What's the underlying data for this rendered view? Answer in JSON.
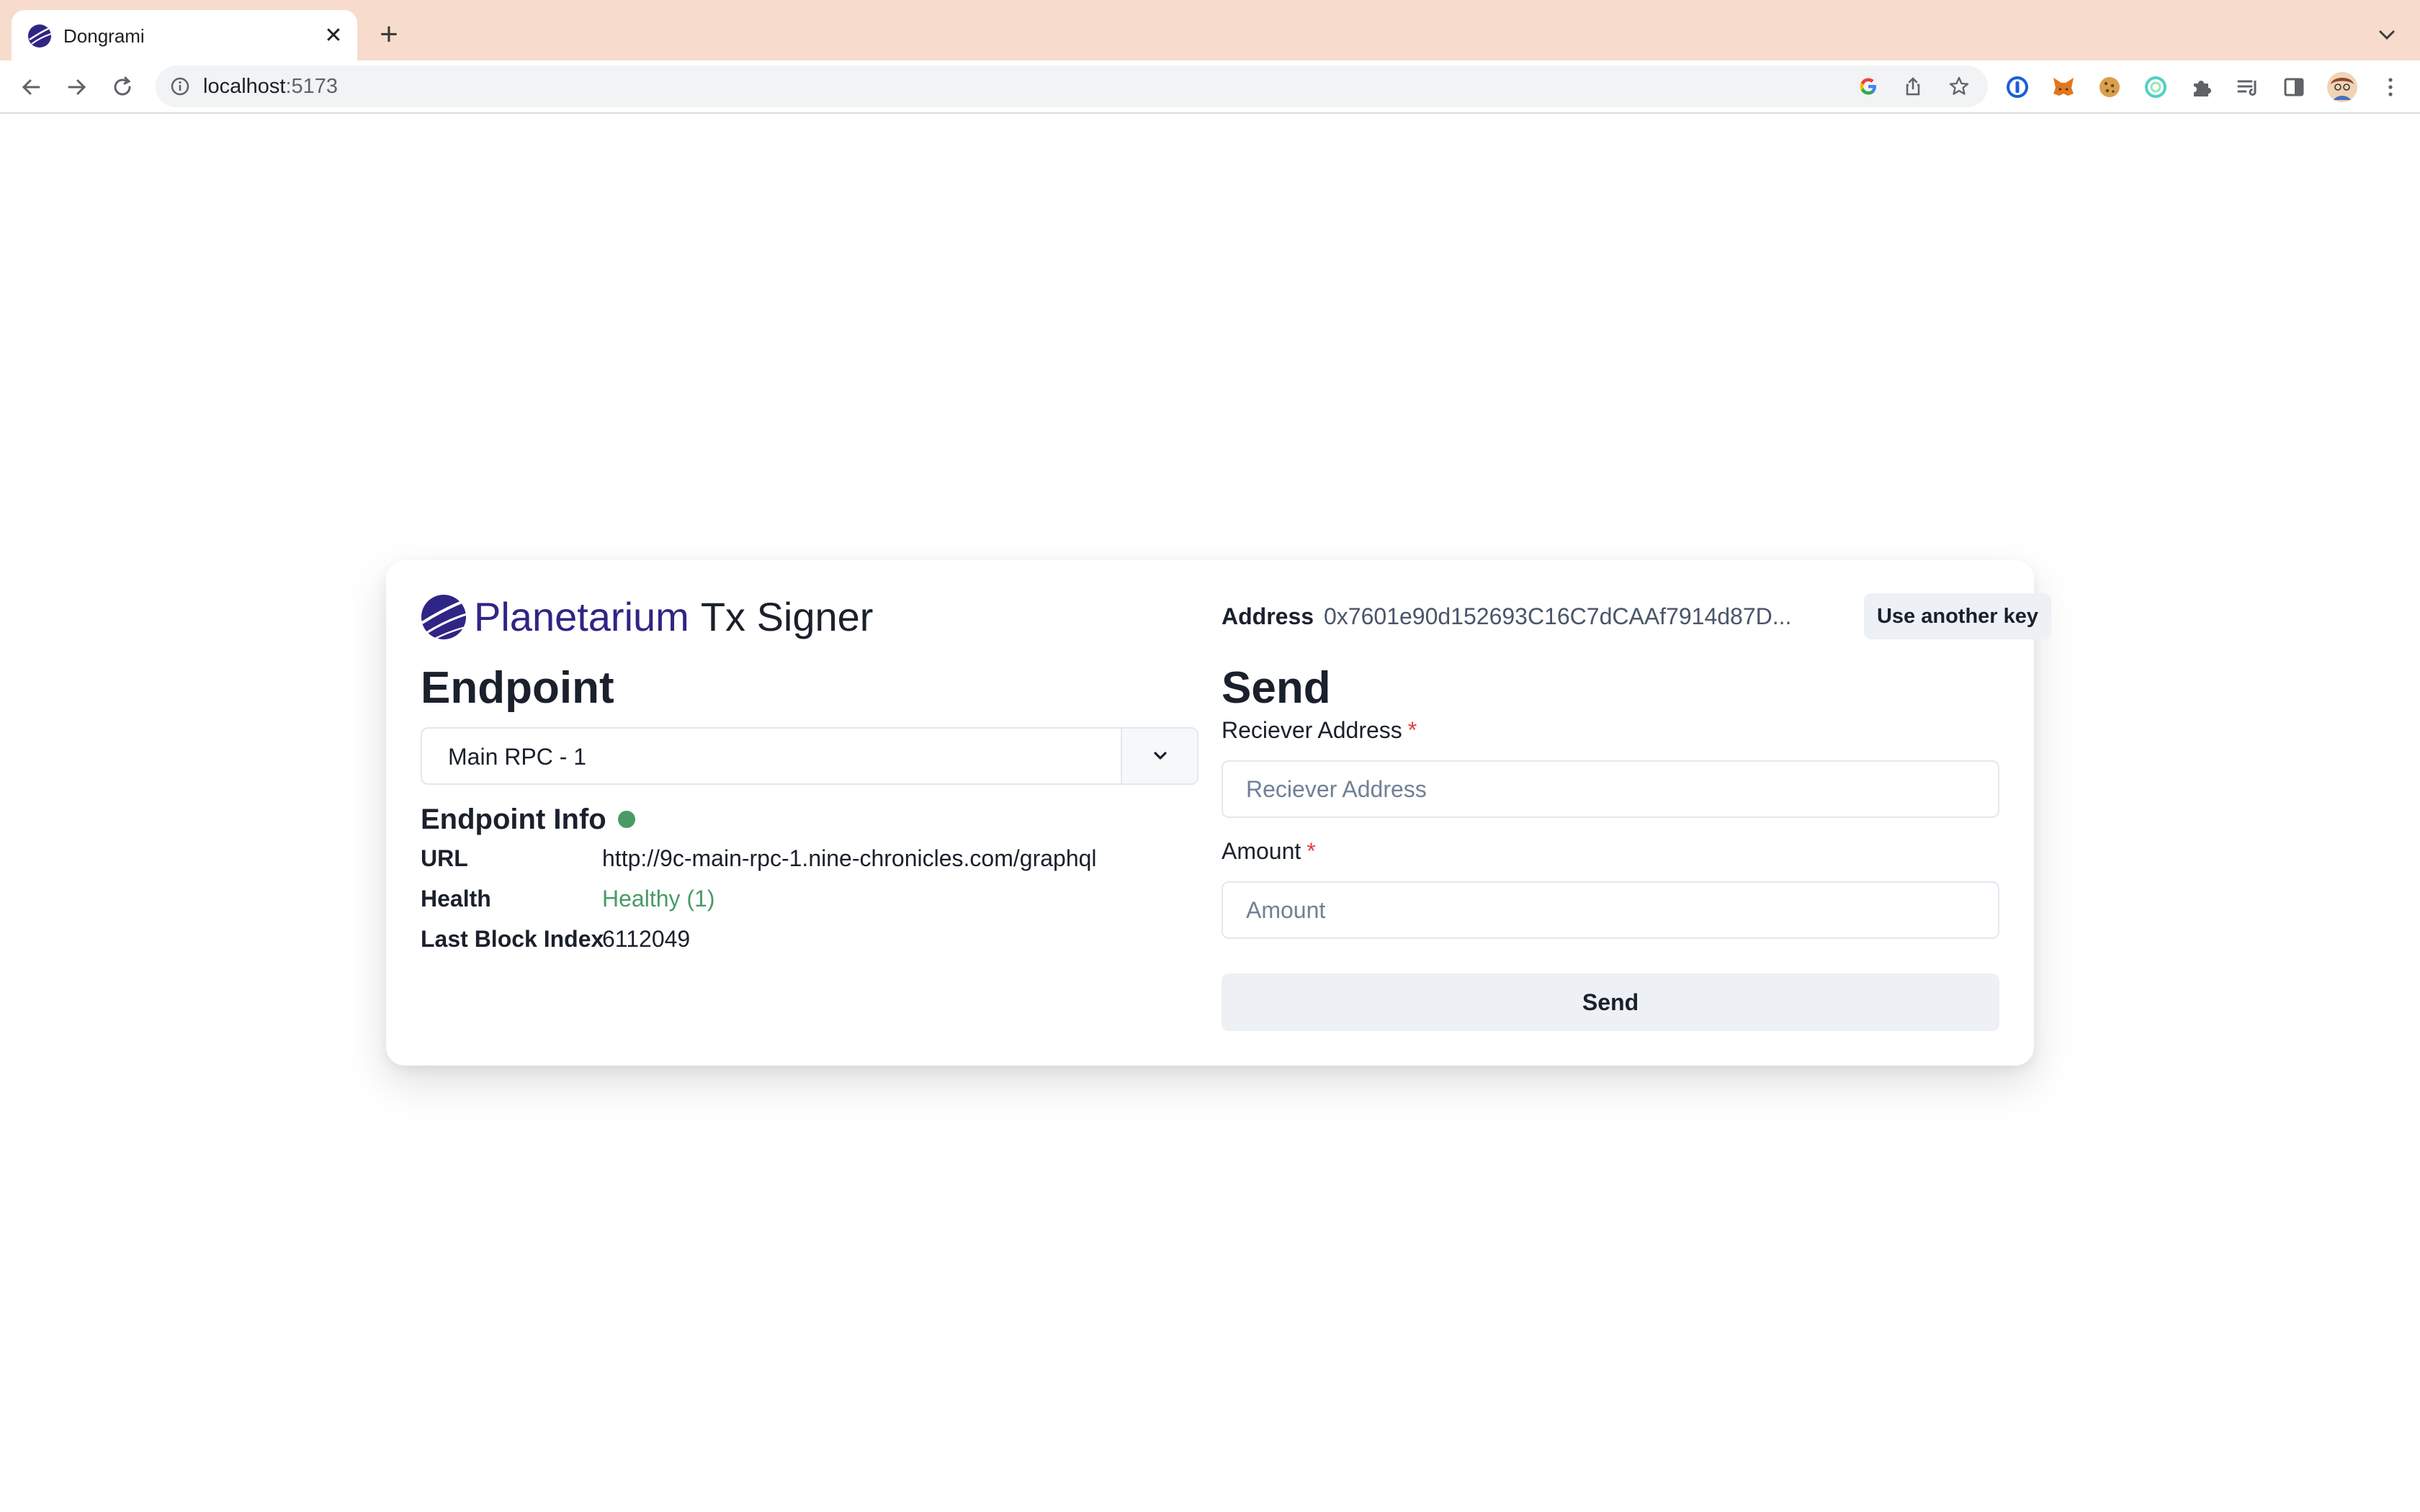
{
  "browser": {
    "tab_title": "Dongrami",
    "tab_close_glyph": "✕",
    "new_tab_glyph": "+",
    "url_host": "localhost",
    "url_port": ":5173",
    "icons": [
      "back-icon",
      "forward-icon",
      "reload-icon",
      "site-info-icon",
      "google-icon",
      "share-icon",
      "bookmark-star-icon",
      "password-manager-icon",
      "metamask-icon",
      "cookie-icon",
      "extension-ring-icon",
      "puzzle-extensions-icon",
      "reading-list-icon",
      "side-panel-icon",
      "profile-avatar",
      "more-menu-icon"
    ],
    "colors": {
      "tabbar": "#f7dccd"
    }
  },
  "app": {
    "brand_name": "Planetarium",
    "brand_suffix": "Tx Signer",
    "colors": {
      "brand": "#2f2584",
      "healthy": "#4a9a66",
      "required": "#e53e3e"
    }
  },
  "endpoint": {
    "heading": "Endpoint",
    "selected": "Main RPC - 1",
    "info_title": "Endpoint Info",
    "rows": [
      {
        "label": "URL",
        "value": "http://9c-main-rpc-1.nine-chronicles.com/graphql"
      },
      {
        "label": "Health",
        "value": "Healthy (1)"
      },
      {
        "label": "Last Block Index",
        "value": "6112049"
      }
    ]
  },
  "account": {
    "address_label": "Address",
    "address_value": "0x7601e90d152693C16C7dCAAf7914d87D...",
    "use_another_key": "Use another key"
  },
  "send": {
    "heading": "Send",
    "receiver_label": "Reciever Address",
    "receiver_placeholder": "Reciever Address",
    "amount_label": "Amount",
    "amount_placeholder": "Amount",
    "required_mark": "*",
    "submit": "Send"
  }
}
